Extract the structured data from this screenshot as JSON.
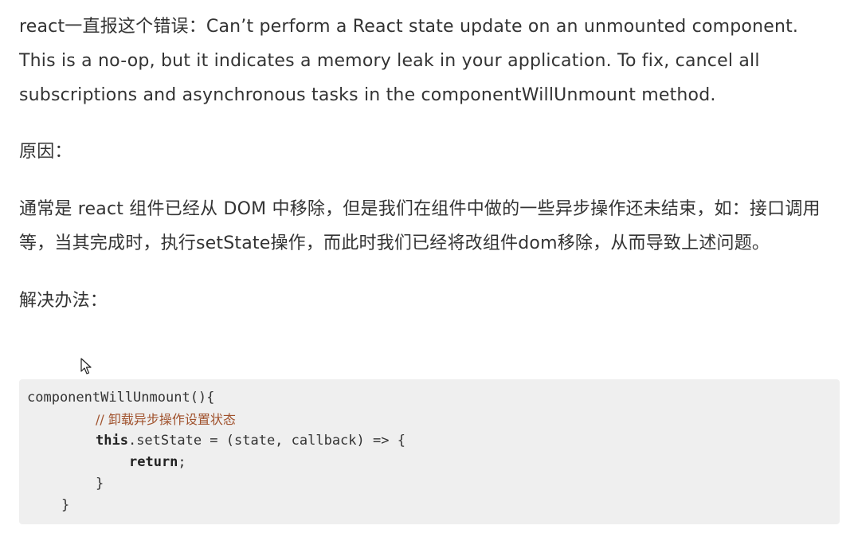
{
  "article": {
    "error_paragraph": "react一直报这个错误：Can’t perform a React state update on an unmounted component. This is a no-op, but it indicates a memory leak in your application. To fix, cancel all subscriptions and asynchronous tasks in the componentWillUnmount method.",
    "cause_label": "原因：",
    "cause_paragraph": "通常是 react 组件已经从 DOM 中移除，但是我们在组件中做的一些异步操作还未结束，如：接口调用等，当其完成时，执行setState操作，而此时我们已经将改组件dom移除，从而导致上述问题。",
    "solution_label": "解决办法："
  },
  "code": {
    "line1": "componentWillUnmount(){",
    "line2_comment": "// 卸载异步操作设置状态",
    "line3_keyword": "this",
    "line3_rest": ".setState = (state, callback) => {",
    "line4_keyword": "return",
    "line4_rest": ";",
    "line5": "}",
    "line6": "}"
  },
  "colors": {
    "text": "#333333",
    "code_background": "#efefef",
    "comment": "#a0522d"
  },
  "icons": {
    "cursor": "mouse-pointer-icon"
  }
}
